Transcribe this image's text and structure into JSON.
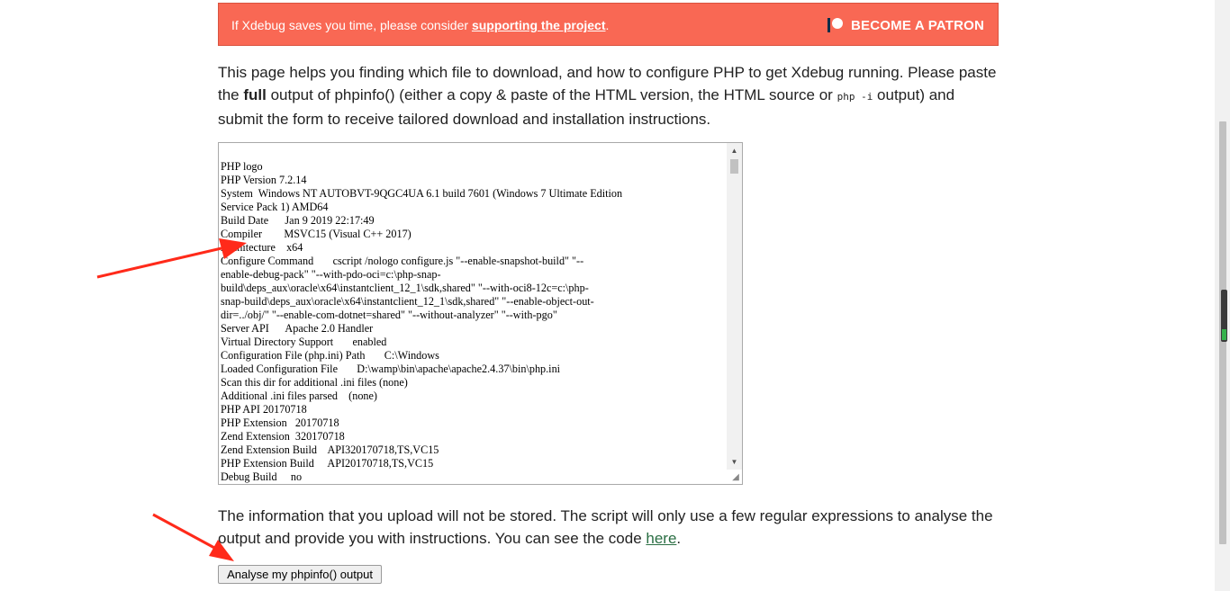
{
  "banner": {
    "text": "If Xdebug saves you time, please consider ",
    "link": "supporting the project",
    "link_suffix": ".",
    "patron_button": "BECOME A PATRON",
    "color": "#f96854"
  },
  "intro": {
    "part1": "This page helps you finding which file to download, and how to configure PHP to get Xdebug running. Please paste the ",
    "bold": "full",
    "part2": " output of phpinfo() (either a copy & paste of the HTML version, the HTML source or ",
    "code": "php -i",
    "part3": " output) and submit the form to receive tailored download and installation instructions."
  },
  "textarea": {
    "content": "PHP logo\nPHP Version 7.2.14\nSystem  Windows NT AUTOBVT-9QGC4UA 6.1 build 7601 (Windows 7 Ultimate Edition\nService Pack 1) AMD64\nBuild Date      Jan 9 2019 22:17:49\nCompiler        MSVC15 (Visual C++ 2017)\nArchitecture    x64\nConfigure Command       cscript /nologo configure.js \"--enable-snapshot-build\" \"--\nenable-debug-pack\" \"--with-pdo-oci=c:\\php-snap-\nbuild\\deps_aux\\oracle\\x64\\instantclient_12_1\\sdk,shared\" \"--with-oci8-12c=c:\\php-\nsnap-build\\deps_aux\\oracle\\x64\\instantclient_12_1\\sdk,shared\" \"--enable-object-out-\ndir=../obj/\" \"--enable-com-dotnet=shared\" \"--without-analyzer\" \"--with-pgo\"\nServer API      Apache 2.0 Handler\nVirtual Directory Support       enabled\nConfiguration File (php.ini) Path       C:\\Windows\nLoaded Configuration File       D:\\wamp\\bin\\apache\\apache2.4.37\\bin\\php.ini\nScan this dir for additional .ini files (none)\nAdditional .ini files parsed    (none)\nPHP API 20170718\nPHP Extension   20170718\nZend Extension  320170718\nZend Extension Build    API320170718,TS,VC15\nPHP Extension Build     API20170718,TS,VC15\nDebug Build     no"
  },
  "info": {
    "text": "The information that you upload will not be stored. The script will only use a few regular expressions to analyse the output and provide you with instructions. You can see the code ",
    "link": "here",
    "suffix": "."
  },
  "submit_label": "Analyse my phpinfo() output",
  "annotation_color": "#ff2a1a"
}
